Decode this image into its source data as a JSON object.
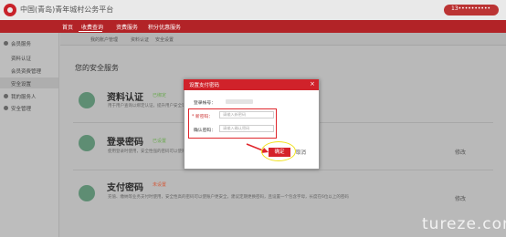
{
  "header": {
    "brand": "中国(青岛)青年城村公务平台",
    "user_label": "13••••••••••",
    "accent_color": "#b22327"
  },
  "nav": {
    "items": [
      "首页",
      "收费查询",
      "资费服务",
      "积分优惠服务"
    ],
    "active_index": 1
  },
  "sidebar": {
    "items": [
      {
        "label": "会员服务",
        "icon": "user-icon"
      },
      {
        "label": "资料认证"
      },
      {
        "label": "会员资费管理"
      },
      {
        "label": "安全设置",
        "active": true
      },
      {
        "label": "我的服务人",
        "icon": "people-icon"
      },
      {
        "label": "安全管理",
        "icon": "shield-icon"
      }
    ]
  },
  "breadcrumb": [
    "我的账户管理",
    "资料认证",
    "安全设置"
  ],
  "main": {
    "title": "您的安全服务",
    "services": [
      {
        "title": "资料认证",
        "status": "已绑定",
        "status_color": "#6aa84f",
        "desc": "用于用户查询以绑定认证，提升用户安全等级",
        "action": "",
        "icon": "id-card-icon"
      },
      {
        "title": "登录密码",
        "status": "已设置",
        "status_color": "#6aa84f",
        "desc": "使用登录时使用，安全性强的密码可以使账号更安全 / 字母组合常用密码",
        "action": "修改",
        "icon": "monitor-icon"
      },
      {
        "title": "支付密码",
        "status": "未设置",
        "status_color": "#d35a3a",
        "desc": "充值、缴纳等业务支付时使用，安全性高的密码可以使账户更安全，建议定期更换密码，且设置一个包含字母，长度在6位以上的密码",
        "action": "修改",
        "icon": "money-bag-icon"
      }
    ]
  },
  "modal": {
    "title": "设置支付密码",
    "close": "×",
    "account_label": "登录帐号：",
    "password_label": "* 新密码：",
    "password_placeholder": "请输入新密码",
    "confirm_label": "确认密码：",
    "confirm_placeholder": "请输入确认密码",
    "confirm_button": "确定",
    "cancel_button": "取消"
  },
  "watermark": "tureze.com"
}
